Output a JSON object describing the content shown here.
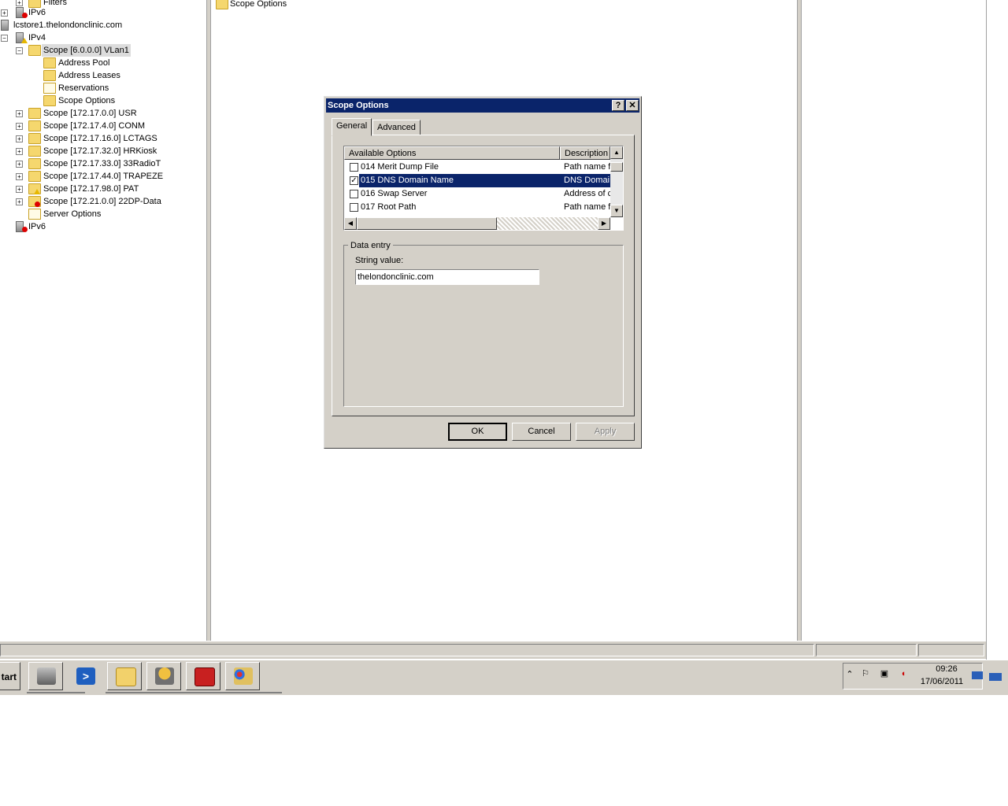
{
  "tree": {
    "filters": "Filters",
    "ipv6_top": "IPv6",
    "server": "lcstore1.thelondonclinic.com",
    "ipv4": "IPv4",
    "scope_vlan1": "Scope [6.0.0.0] VLan1",
    "address_pool": "Address Pool",
    "address_leases": "Address Leases",
    "reservations": "Reservations",
    "scope_options": "Scope Options",
    "scopes": [
      "Scope [172.17.0.0] USR",
      "Scope [172.17.4.0] CONM",
      "Scope [172.17.16.0] LCTAGS",
      "Scope [172.17.32.0] HRKiosk",
      "Scope [172.17.33.0] 33RadioT",
      "Scope [172.17.44.0] TRAPEZE",
      "Scope [172.17.98.0] PAT",
      "Scope [172.21.0.0] 22DP-Data"
    ],
    "server_options": "Server Options",
    "ipv6_bottom": "IPv6"
  },
  "center": {
    "item": "Scope Options"
  },
  "dialog": {
    "title": "Scope Options",
    "help": "?",
    "close": "✕",
    "tabs": [
      "General",
      "Advanced"
    ],
    "columns": [
      "Available Options",
      "Description"
    ],
    "options": [
      {
        "name": "014 Merit Dump File",
        "desc": "Path name f",
        "checked": false
      },
      {
        "name": "015 DNS Domain Name",
        "desc": "DNS Domai",
        "checked": true
      },
      {
        "name": "016 Swap Server",
        "desc": "Address of c",
        "checked": false
      },
      {
        "name": "017 Root Path",
        "desc": "Path name f",
        "checked": false
      }
    ],
    "data_entry_label": "Data entry",
    "string_value_label": "String value:",
    "string_value": "thelondonclinic.com",
    "ok": "OK",
    "cancel": "Cancel",
    "apply": "Apply"
  },
  "taskbar": {
    "start": "tart",
    "time": "09:26",
    "date": "17/06/2011",
    "apps": [
      "server-manager-icon",
      "powershell-icon",
      "explorer-icon",
      "dhcp-icon",
      "toolbox-icon",
      "paint-icon"
    ]
  }
}
